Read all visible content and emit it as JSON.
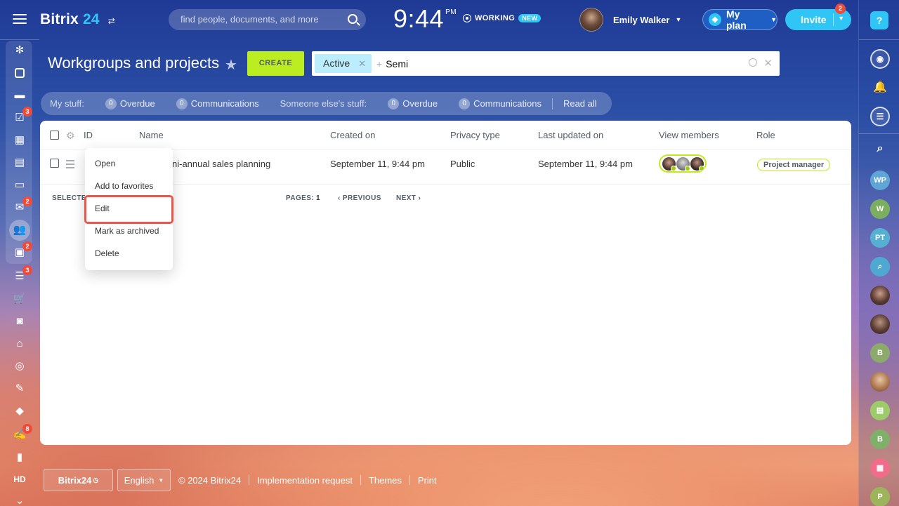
{
  "header": {
    "logo_name": "Bitrix",
    "logo_number": "24",
    "search_placeholder": "find people, documents, and more",
    "clock_time": "9:44",
    "clock_ampm": "PM",
    "working_label": "WORKING",
    "new_badge": "NEW",
    "user_name": "Emily Walker",
    "myplan_label": "My plan",
    "invite_label": "Invite",
    "invite_badge": "2"
  },
  "left_sidebar": {
    "badges": {
      "tasks": "3",
      "mail": "2",
      "contacts": "2",
      "crm": "3",
      "notes": "8"
    },
    "hd_label": "HD"
  },
  "right_sidebar": {
    "help_label": "?",
    "circles": [
      {
        "label": "WP",
        "color": "#5fa5d6"
      },
      {
        "label": "W",
        "color": "#7cae5f"
      },
      {
        "label": "PT",
        "color": "#56b0d2"
      },
      {
        "label": "B",
        "color": "#8caa6a"
      },
      {
        "label": "B",
        "color": "#7fb06a"
      },
      {
        "label": "P",
        "color": "#9cb45a"
      }
    ]
  },
  "page": {
    "title": "Workgroups and projects",
    "create_label": "CREATE",
    "filter_chip": "Active",
    "filter_query": "Semi"
  },
  "counters": {
    "my_stuff": "My stuff:",
    "overdue_count_1": "0",
    "overdue_1": "Overdue",
    "comm_count_1": "0",
    "communications_1": "Communications",
    "someone_else": "Someone else's stuff:",
    "overdue_count_2": "0",
    "overdue_2": "Overdue",
    "comm_count_2": "0",
    "communications_2": "Communications",
    "read_all": "Read all"
  },
  "table": {
    "headers": {
      "id": "ID",
      "name": "Name",
      "created": "Created on",
      "privacy": "Privacy type",
      "updated": "Last updated on",
      "members": "View members",
      "role": "Role"
    },
    "rows": [
      {
        "name": "Semi-annual sales planning",
        "name_visible": "ni-annual sales planning",
        "created": "September 11, 9:44 pm",
        "privacy": "Public",
        "updated": "September 11, 9:44 pm",
        "role": "Project manager"
      }
    ],
    "selected_label": "SELECTED",
    "pages_label": "PAGES:",
    "page_number": "1",
    "previous_label": "PREVIOUS",
    "next_label": "NEXT"
  },
  "context_menu": {
    "items": [
      "Open",
      "Add to favorites",
      "Edit",
      "Mark as archived",
      "Delete"
    ],
    "highlighted": "Edit"
  },
  "footer": {
    "brand": "Bitrix24",
    "language": "English",
    "copyright": "© 2024 Bitrix24",
    "links": [
      "Implementation request",
      "Themes",
      "Print"
    ]
  },
  "colors": {
    "accent_green": "#bbed21",
    "accent_blue": "#2fc6f6",
    "badge_red": "#f04a3b",
    "highlight_red": "#e8574b"
  }
}
